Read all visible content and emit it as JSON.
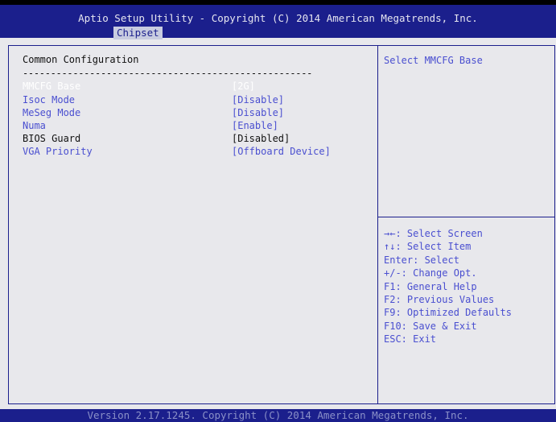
{
  "header": {
    "title": "Aptio Setup Utility - Copyright (C) 2014 American Megatrends, Inc.",
    "tab": "Chipset"
  },
  "main": {
    "section_title": "Common Configuration",
    "separator": "----------------------------------------------------",
    "settings": [
      {
        "label": "MMCFG Base",
        "value": "[2G]",
        "state": "selected"
      },
      {
        "label": "Isoc Mode",
        "value": "[Disable]",
        "state": "normal"
      },
      {
        "label": "MeSeg Mode",
        "value": "[Disable]",
        "state": "normal"
      },
      {
        "label": "Numa",
        "value": "[Enable]",
        "state": "normal"
      },
      {
        "label": "BIOS Guard",
        "value": "[Disabled]",
        "state": "grayed"
      },
      {
        "label": "VGA Priority",
        "value": "[Offboard Device]",
        "state": "normal"
      }
    ]
  },
  "help": {
    "text": "Select MMCFG Base",
    "keys": [
      "→←: Select Screen",
      "↑↓: Select Item",
      "Enter: Select",
      "+/-: Change Opt.",
      "F1: General Help",
      "F2: Previous Values",
      "F9: Optimized Defaults",
      "F10: Save & Exit",
      "ESC: Exit"
    ]
  },
  "footer": {
    "text": "Version 2.17.1245. Copyright (C) 2014 American Megatrends, Inc."
  },
  "colors": {
    "header_bg": "#1b1f8c",
    "panel_bg": "#e8e8ec",
    "selectable_text": "#4a4fd0",
    "selected_text": "#ffffff",
    "static_text": "#111111"
  }
}
